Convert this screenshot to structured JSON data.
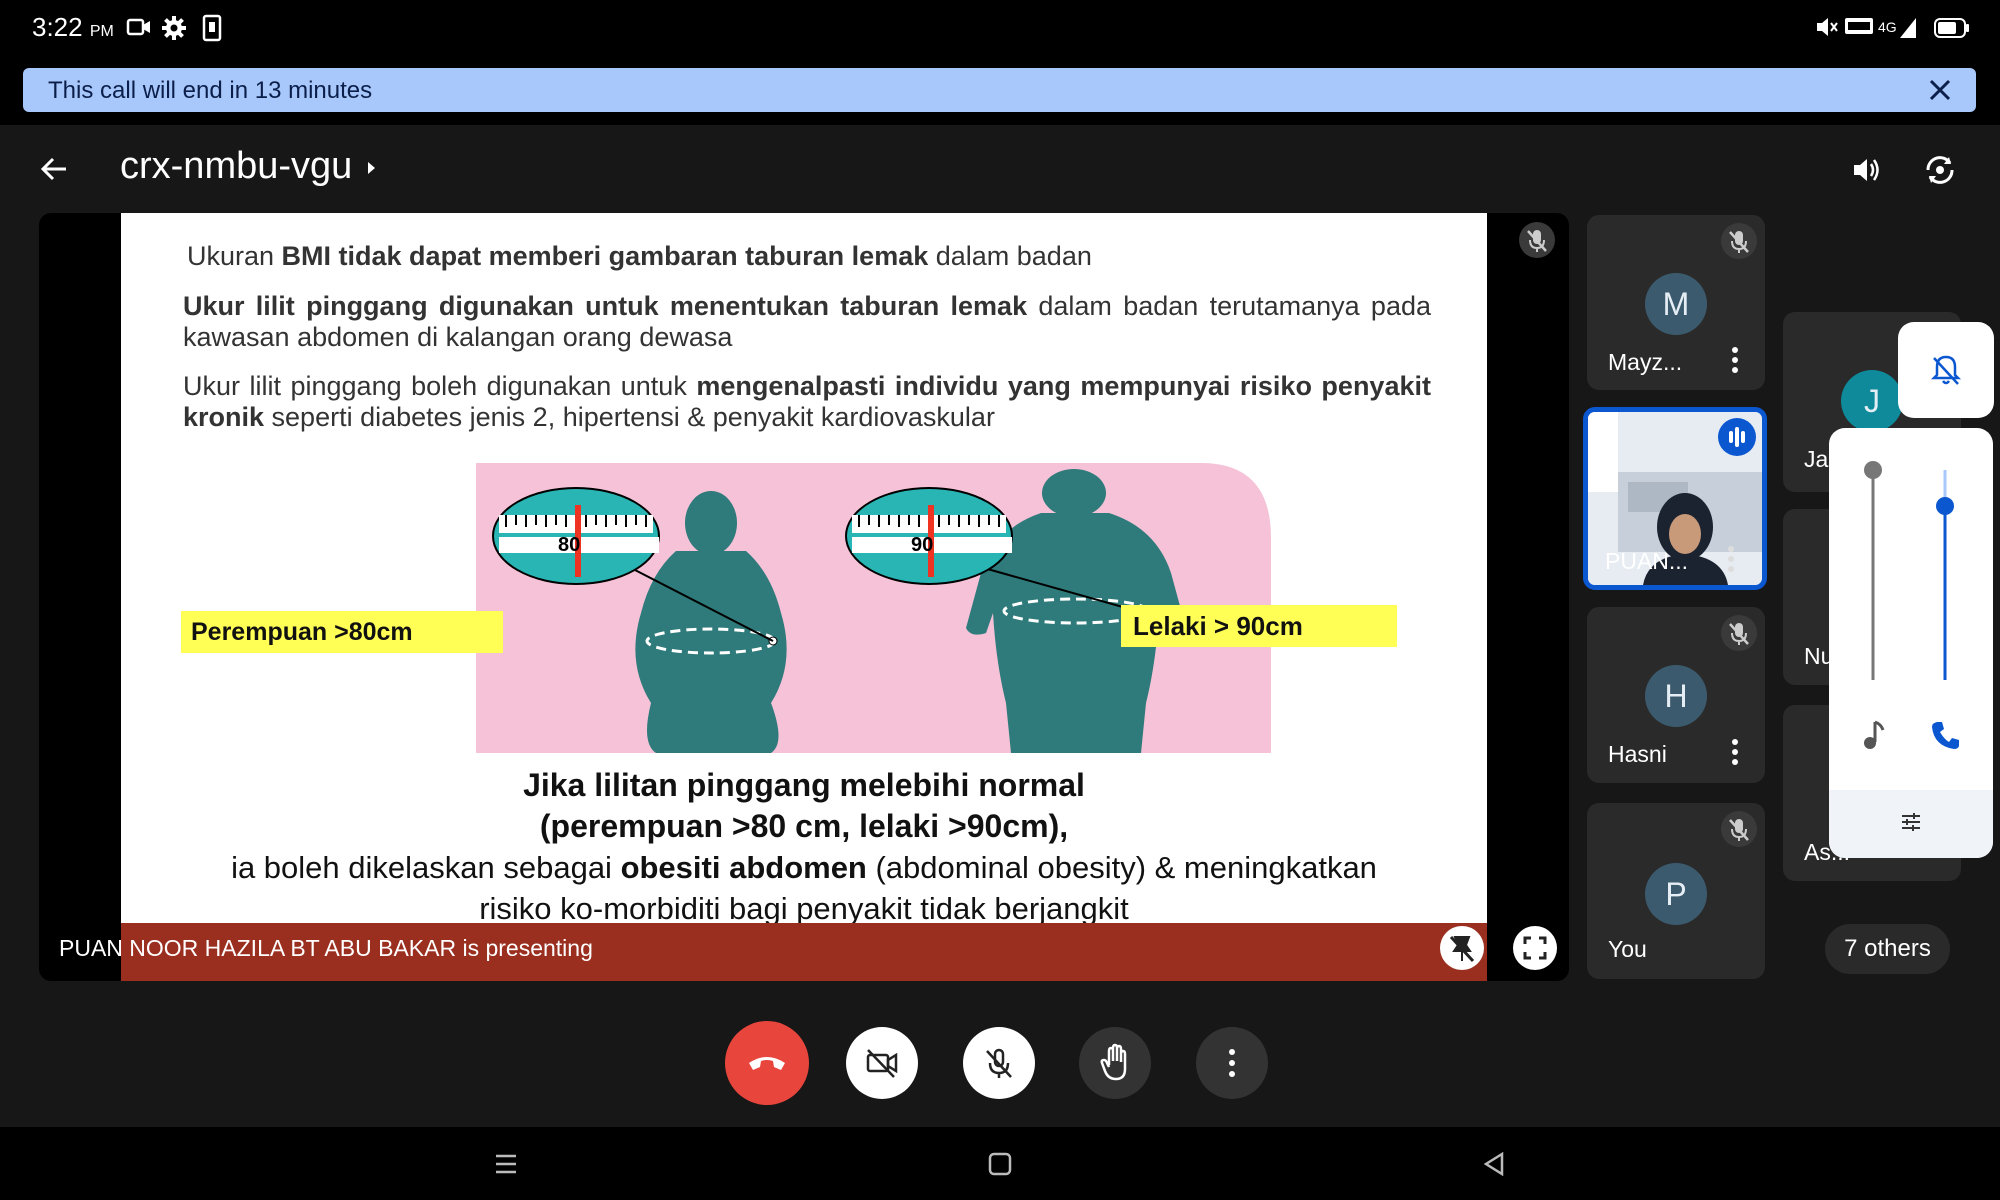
{
  "status": {
    "time": "3:22",
    "ampm": "PM"
  },
  "banner": {
    "text": "This call will end in 13 minutes"
  },
  "meeting": {
    "code": "crx-nmbu-vgu"
  },
  "slide": {
    "p1_pre": "Ukuran ",
    "p1_bold": "BMI tidak dapat memberi gambaran taburan lemak",
    "p1_post": " dalam badan",
    "p2_bold": "Ukur lilit pinggang digunakan untuk menentukan taburan lemak",
    "p2_post": " dalam badan terutamanya pada kawasan abdomen di kalangan orang dewasa",
    "p3_pre": "Ukur lilit pinggang boleh digunakan untuk ",
    "p3_bold": "mengenalpasti individu yang mempunyai risiko penyakit kronik",
    "p3_post": " seperti diabetes jenis 2, hipertensi & penyakit kardiovaskular",
    "tape1": "80",
    "tape2": "90",
    "label_female": "Perempuan >80cm",
    "label_male": "Lelaki > 90cm",
    "c1": "Jika lilitan pinggang melebihi normal",
    "c2": "(perempuan >80 cm, lelaki >90cm),",
    "c3_pre": "ia boleh dikelaskan sebagai ",
    "c3_bold": "obesiti abdomen",
    "c3_post": " (abdominal obesity) & meningkatkan",
    "c4": "risiko ko-morbiditi bagi penyakit tidak berjangkit"
  },
  "presenting": {
    "text": "PUAN NOOR HAZILA BT ABU BAKAR is presenting"
  },
  "participants": [
    {
      "initial": "M",
      "name": "Mayz..."
    },
    {
      "initial": "",
      "name": "PUAN..."
    },
    {
      "initial": "H",
      "name": "Hasni"
    },
    {
      "initial": "P",
      "name": "You"
    }
  ],
  "right_tiles": [
    {
      "initial": "J",
      "name": "Ja"
    },
    {
      "initial": "",
      "name": "Nu"
    },
    {
      "initial": "",
      "name": "As..."
    }
  ],
  "others": {
    "label": "7 others"
  },
  "colors": {
    "end_call": "#e8453c",
    "banner": "#a8c7fa",
    "speaking": "#0b57d0",
    "present_bar": "#9a2f1f"
  }
}
